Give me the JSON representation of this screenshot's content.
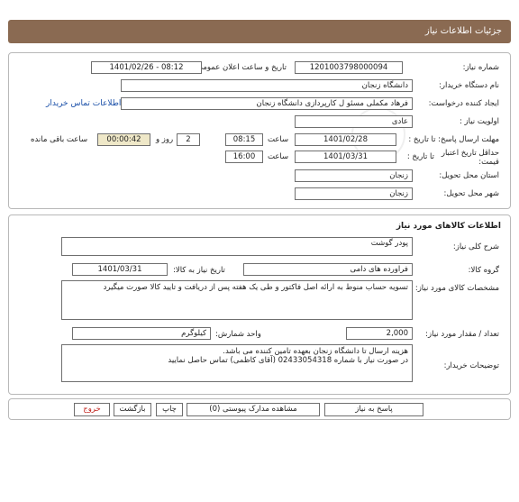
{
  "header": {
    "title": "جزئیات اطلاعات نیاز"
  },
  "need_info": {
    "need_number_label": "شماره نیاز:",
    "need_number": "1201003798000094",
    "announce_label": "تاریخ و ساعت اعلان عمومی:",
    "announce_value": "1401/02/26 - 08:12",
    "buyer_org_label": "نام دستگاه خریدار:",
    "buyer_org": "دانشگاه زنجان",
    "requester_label": "ایجاد کننده درخواست:",
    "requester": "فرهاد مکملی مسئو ل کارپردازی دانشگاه زنجان",
    "contact_link": "اطلاعات تماس خریدار",
    "priority_label": "اولویت نیاز :",
    "priority": "عادی",
    "reply_deadline_label": "مهلت ارسال پاسخ: تا تاریخ :",
    "reply_date": "1401/02/28",
    "time_label": "ساعت",
    "reply_time": "08:15",
    "days_value": "2",
    "days_label": "روز و",
    "remaining_time": "00:00:42",
    "remaining_label": "ساعت باقی مانده",
    "price_validity_label": "حداقل تاریخ اعتبار قیمت:",
    "price_validity_to": "تا تاریخ :",
    "validity_date": "1401/03/31",
    "validity_time": "16:00",
    "delivery_province_label": "استان محل تحویل:",
    "delivery_province": "زنجان",
    "delivery_city_label": "شهر محل تحویل:",
    "delivery_city": "زنجان"
  },
  "goods": {
    "section_title": "اطلاعات کالاهای مورد نیاز",
    "summary_label": "شرح کلی نیاز:",
    "summary": "پودر گوشت",
    "group_label": "گروه کالا:",
    "group_value": "فراورده های دامی",
    "need_date_label": "تاریخ نیاز به کالا:",
    "need_date": "1401/03/31",
    "spec_label": "مشخصات کالای مورد نیاز:",
    "spec": "تسویه حساب منوط به ارائه اصل فاکتور و طی یک هفته پس از دریافت و تایید کالا صورت میگیرد",
    "qty_label": "تعداد / مقدار مورد نیاز:",
    "qty": "2,000",
    "unit_label": "واحد شمارش:",
    "unit": "کیلوگرم",
    "buyer_notes_label": "توضیحات خریدار:",
    "buyer_notes_line1": "هزینه ارسال تا دانشگاه زنجان بعهده تامین کننده می باشد.",
    "buyer_notes_line2": "در صورت نیاز با شماره 02433054318 (آقای کاظمی) تماس حاصل نمایید"
  },
  "actions": {
    "reply": "پاسخ به نیاز",
    "attachments": "مشاهده مدارک پیوستی (0)",
    "print": "چاپ",
    "back": "بازگشت",
    "exit": "خروج"
  },
  "colors": {
    "header_bg": "#8a6a52",
    "link": "#1a4fa8",
    "exit": "#c0201a"
  }
}
